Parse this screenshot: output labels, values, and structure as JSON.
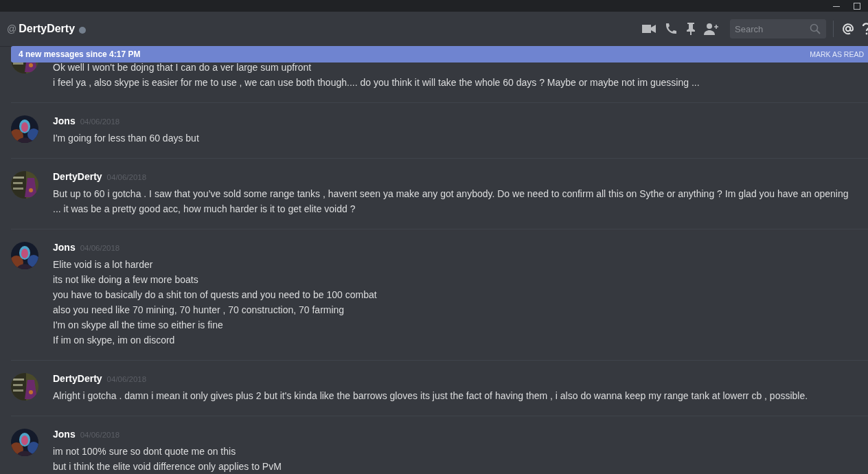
{
  "channel": {
    "at": "@",
    "name": "DertyDerty",
    "online": false
  },
  "search": {
    "placeholder": "Search"
  },
  "banner": {
    "text": "4 new messages since 4:17 PM",
    "action": "MARK AS READ"
  },
  "messages": [
    {
      "header": false,
      "lines": [
        "Ok well I won't be dojng that I can do a ver large sum upfront",
        "i feel ya , also skype is easier for me to use , we can use both though.... do you think it will take the whole 60 days ? Maybe or maybe not im guessing ..."
      ]
    },
    {
      "header": true,
      "author": "Jons",
      "time": "04/06/2018",
      "lines": [
        "I'm going for less than 60 days but"
      ]
    },
    {
      "header": true,
      "author": "DertyDerty",
      "time": "04/06/2018",
      "lines": [
        "But up to 60 i gotcha . I saw that you’ve sold some range tanks , havent seen ya make any got anybody. Do we need to confirm all this on Sythe or anything ? Im glad you have an opening ... it was be a pretty good acc, how much harder is it to get elite voidd ?"
      ]
    },
    {
      "header": true,
      "author": "Jons",
      "time": "04/06/2018",
      "lines": [
        "Elite void is a lot harder",
        "its not like doing a few more boats",
        "you have to basically do a shit ton of quests and you need to be 100 combat",
        "also you need like 70 mining, 70 hunter , 70 construction, 70 farming",
        "I'm on skype all the time so either is fine",
        "If im on skype, im on discord"
      ]
    },
    {
      "header": true,
      "author": "DertyDerty",
      "time": "04/06/2018",
      "lines": [
        "Alright i gotcha . damn i mean it only gives plus 2 but it's kinda like the barrows gloves its just the fact of having them , i also do wanna keep my range tank at lowerr cb , possible."
      ]
    },
    {
      "header": true,
      "author": "Jons",
      "time": "04/06/2018",
      "lines": [
        "im not 100% sure so dont quote me on this",
        "but i think the elite void difference only applies to PvM"
      ]
    }
  ]
}
